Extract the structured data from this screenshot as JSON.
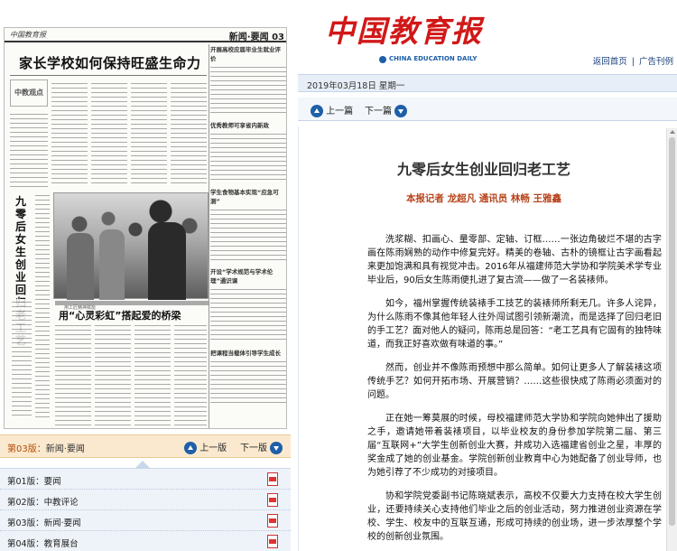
{
  "paper": {
    "masthead": "中国教育报",
    "section_label": "新闻·要闻 03",
    "headline": "家长学校如何保持旺盛生命力",
    "stamp": "中教观点",
    "vertical_headline": "九零后女生创业回归老工艺",
    "photo_caption": "",
    "sub_kicker": "用工匠精神赋能",
    "sub_headline": "用“心灵彩虹”搭起爱的桥梁",
    "side_titles": [
      "开展高校应届毕业生就业评价",
      "优秀教师可享省内新政",
      "学生食物基本实现“应急可测”",
      "开设“学术规范与学术伦理”通识课",
      "把课程当载体引导学生成长"
    ]
  },
  "pagebar": {
    "current_label": "第03版：",
    "current_name": "新闻·要闻",
    "prev": "上一版",
    "next": "下一版"
  },
  "pages": [
    {
      "label": "第01版：要闻"
    },
    {
      "label": "第02版：中教评论"
    },
    {
      "label": "第03版：新闻·要闻"
    },
    {
      "label": "第04版：教育展台"
    }
  ],
  "brand": {
    "chinese": "中国教育报",
    "english": "CHINA EDUCATION DAILY"
  },
  "toplinks": {
    "home": "返回首页",
    "sep": "|",
    "print": "广告刊例"
  },
  "date": "2019年03月18日  星期一",
  "artnav": {
    "prev": "上一篇",
    "next": "下一篇"
  },
  "article": {
    "title": "九零后女生创业回归老工艺",
    "byline": "本报记者  龙超凡  通讯员  林畅  王雅鑫",
    "paragraphs": [
      "洗浆糊、扣画心、量零部、定轴、订框……一张边角破烂不堪的古字画在陈雨娴熟的动作中修复完好。精美的卷轴、古朴的镜框让古字画看起来更加饱满和具有视觉冲击。2016年从福建师范大学协和学院美术学专业毕业后，90后女生陈雨便扎进了复古流——做了一名装裱师。",
      "如今，福州掌握传统装裱手工技艺的装裱师所剩无几。许多人诧异，为什么陈雨不像其他年轻人往外闯试图引领新潮流，而是选择了回归老旧的手工艺？面对他人的疑问，陈雨总是回答：“老工艺具有它固有的独特味道，而我正好喜欢做有味道的事。”",
      "然而，创业并不像陈雨预想中那么简单。如何让更多人了解装裱这项传统手艺？如何开拓市场、开展营销？……这些很快成了陈雨必须面对的问题。",
      "正在她一筹莫展的时候，母校福建师范大学协和学院向她伸出了援助之手，邀请她带着装裱项目，以毕业校友的身份参加学院第二届、第三届“互联网+”大学生创新创业大赛，并成功入选福建省创业之星，丰厚的奖金成了她的创业基金。学院创新创业教育中心为她配备了创业导师，也为她引荐了不少成功的对接项目。",
      "协和学院党委副书记陈晓斌表示，高校不仅要大力支持在校大学生创业，还要持续关心支持他们毕业之后的创业活动，努力推进创业资源在学校、学生、校友中的互联互通，形成可持续的创业场，进一步浓厚整个学校的创新创业氛围。"
    ]
  }
}
